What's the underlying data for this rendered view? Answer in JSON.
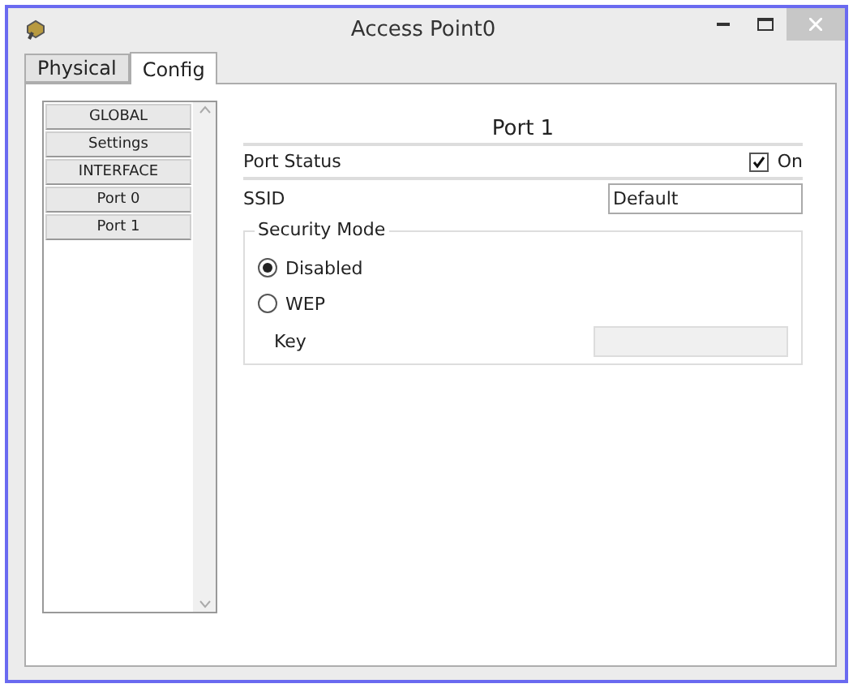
{
  "window": {
    "title": "Access Point0"
  },
  "tabs": [
    {
      "label": "Physical",
      "selected": false
    },
    {
      "label": "Config",
      "selected": true
    }
  ],
  "sidebar": {
    "items": [
      {
        "label": "GLOBAL"
      },
      {
        "label": "Settings"
      },
      {
        "label": "INTERFACE"
      },
      {
        "label": "Port 0"
      },
      {
        "label": "Port 1"
      }
    ]
  },
  "panel": {
    "heading": "Port 1",
    "port_status": {
      "label": "Port Status",
      "checked": true,
      "option": "On"
    },
    "ssid": {
      "label": "SSID",
      "value": "Default"
    },
    "security_mode": {
      "legend": "Security Mode",
      "options": [
        {
          "label": "Disabled",
          "selected": true
        },
        {
          "label": "WEP",
          "selected": false
        }
      ],
      "key": {
        "label": "Key",
        "disabled": true
      }
    }
  }
}
